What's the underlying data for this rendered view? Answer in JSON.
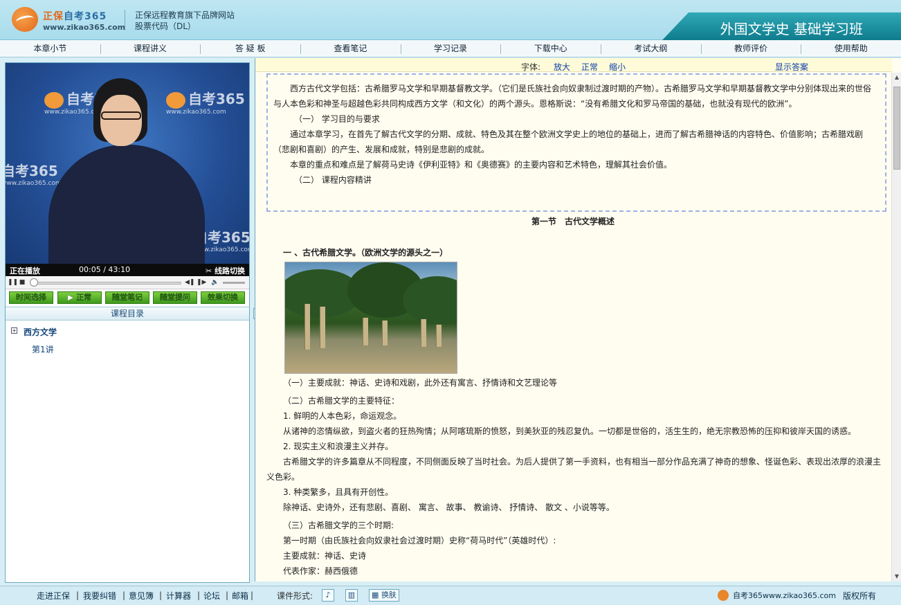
{
  "header": {
    "brand_prefix": "正保",
    "brand_rest": "自考365",
    "brand_url": "www.zikao365.com",
    "tagline1": "正保远程教育旗下品牌网站",
    "tagline2": "股票代码（DL）",
    "course_title": "外国文学史 基础学习班"
  },
  "nav": [
    "本章小节",
    "课程讲义",
    "答 疑 板",
    "查看笔记",
    "学习记录",
    "下载中心",
    "考试大纲",
    "教师评价",
    "使用帮助"
  ],
  "player": {
    "watermark": "自考365",
    "watermark_url": "www.zikao365.com",
    "status": "正在播放",
    "time_current": "00:05",
    "time_sep": "/",
    "time_total": "43:10",
    "switch_line": "线路切换",
    "progress_fraction": 0.001
  },
  "player_buttons": [
    "时间选择",
    "▶ 正常",
    "随堂笔记",
    "随堂提问",
    "效果切换"
  ],
  "catalog": {
    "title": "课程目录",
    "root": "西方文学",
    "child": "第1讲"
  },
  "font_bar": {
    "label": "字体:",
    "enlarge": "放大",
    "normal": "正常",
    "shrink": "缩小",
    "show_answer": "显示答案"
  },
  "content": {
    "box_p1": "西方古代文学包括：古希腊罗马文学和早期基督教文学。（它们是氏族社会向奴隶制过渡时期的产物）。古希腊罗马文学和早期基督教文学中分别体现出来的世俗与人本色彩和神圣与超越色彩共同构成西方文学（和文化）的两个源头。恩格斯说：“没有希腊文化和罗马帝国的基础，也就没有现代的欧洲”。",
    "box_h1": "（一） 学习目的与要求",
    "box_p2": "通过本章学习，在首先了解古代文学的分期、成就、特色及其在整个欧洲文学史上的地位的基础上，进而了解古希腊神话的内容特色、价值影响；古希腊戏剧（悲剧和喜剧）的产生、发展和成就，特别是悲剧的成就。",
    "box_p3": "本章的重点和难点是了解荷马史诗《伊利亚特》和《奥德赛》的主要内容和艺术特色，理解其社会价值。",
    "box_h2": "（二） 课程内容精讲",
    "section_title": "第一节　古代文学概述",
    "heading1": "一 、古代希腊文学。（欧洲文学的源头之一）",
    "l1": "（一）主要成就：神话、史诗和戏剧，此外还有寓言、抒情诗和文艺理论等",
    "l2": "（二）古希腊文学的主要特征：",
    "l3": "1. 鲜明的人本色彩，命运观念。",
    "l4": "从诸神的恣情纵欲，到盗火者的狂热殉情；从阿喀琉斯的愤怒，到美狄亚的残忍复仇。一切都是世俗的，活生生的，绝无宗教恐怖的压抑和彼岸天国的诱惑。",
    "l5": "2. 现实主义和浪漫主义并存。",
    "l6": "古希腊文学的许多篇章从不同程度，不同侧面反映了当时社会。为后人提供了第一手资料，也有相当一部分作品充满了神奇的想象、怪诞色彩、表现出浓厚的浪漫主义色彩。",
    "l7": "3. 种类繁多，且具有开创性。",
    "l8": "除神话、史诗外，还有悲剧、喜剧、 寓言、 故事、 教谕诗、 抒情诗、 散文 、小说等等。",
    "l9": "（三）古希腊文学的三个时期:",
    "l10": "第一时期（由氏族社会向奴隶社会过渡时期）史称“荷马时代”（英雄时代）:",
    "l11": "主要成就：神话、史诗",
    "l12": "代表作家：赫西俄德"
  },
  "footer": {
    "links": [
      "走进正保",
      "我要纠错",
      "意见簿",
      "计算器",
      "论坛",
      "邮箱"
    ],
    "format_label": "课件形式:",
    "skin": "换肤",
    "site": "自考365www.zikao365.com",
    "copyright": "版权所有"
  },
  "colors": {
    "accent": "#0f7c8d",
    "link": "#0a3fa8",
    "button_green": "#3e9a1d"
  }
}
